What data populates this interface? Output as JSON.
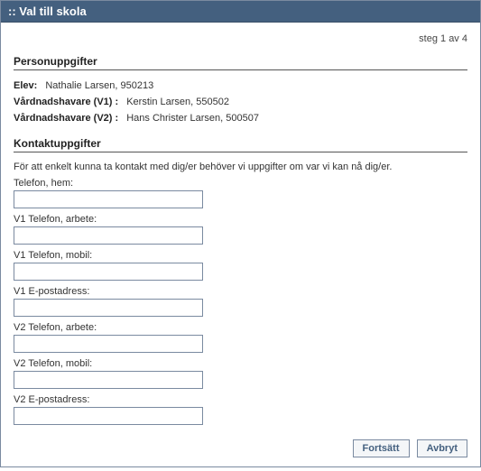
{
  "titlebar": ":: Val till skola",
  "step_text": "steg 1 av 4",
  "section_person": {
    "title": "Personuppgifter",
    "rows": {
      "elev_label": "Elev:",
      "elev_value": "Nathalie Larsen, 950213",
      "v1_label": "Vårdnadshavare (V1) :",
      "v1_value": "Kerstin Larsen, 550502",
      "v2_label": "Vårdnadshavare (V2) :",
      "v2_value": "Hans Christer Larsen, 500507"
    }
  },
  "section_contact": {
    "title": "Kontaktuppgifter",
    "instruction": "För att enkelt kunna ta kontakt med dig/er behöver vi uppgifter om var vi kan nå dig/er.",
    "fields": {
      "tel_hem_label": "Telefon, hem:",
      "tel_hem_value": "",
      "v1_tel_arbete_label": "V1 Telefon, arbete:",
      "v1_tel_arbete_value": "",
      "v1_tel_mobil_label": "V1 Telefon, mobil:",
      "v1_tel_mobil_value": "",
      "v1_epost_label": "V1 E-postadress:",
      "v1_epost_value": "",
      "v2_tel_arbete_label": "V2 Telefon, arbete:",
      "v2_tel_arbete_value": "",
      "v2_tel_mobil_label": "V2 Telefon, mobil:",
      "v2_tel_mobil_value": "",
      "v2_epost_label": "V2 E-postadress:",
      "v2_epost_value": ""
    }
  },
  "buttons": {
    "continue": "Fortsätt",
    "cancel": "Avbryt"
  }
}
